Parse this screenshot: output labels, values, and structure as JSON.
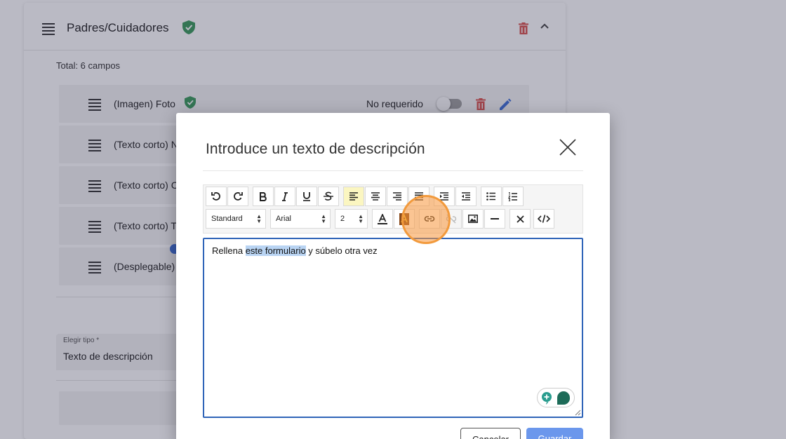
{
  "section": {
    "title": "Padres/Cuidadores",
    "total": "Total: 6 campos",
    "fields": [
      {
        "label": "(Imagen) Foto",
        "required_label": "No requerido"
      },
      {
        "label": "(Texto corto) N"
      },
      {
        "label": "(Texto corto) C"
      },
      {
        "label": "(Texto corto) T"
      },
      {
        "label": "(Desplegable) I"
      }
    ],
    "type_select": {
      "label": "Elegir tipo *",
      "value": "Texto de descripción"
    }
  },
  "modal": {
    "title": "Introduce un texto de descripción",
    "toolbar": {
      "format_select": "Standard",
      "font_select": "Arial",
      "size_select": "2"
    },
    "editor": {
      "text_before": "Rellena ",
      "text_selected": "este formulario",
      "text_after": " y súbelo otra vez"
    },
    "cancel_label": "Cancelar",
    "save_label": "Guardar"
  },
  "colors": {
    "accent": "#2f64b8",
    "save": "#6b97ec",
    "delete": "#d9534f",
    "verified": "#3a9a5b",
    "click_marker": "#f29a3c"
  }
}
